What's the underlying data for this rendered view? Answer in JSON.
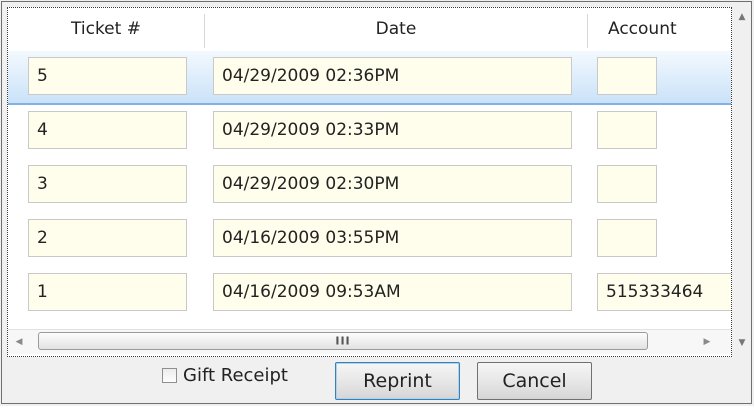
{
  "columns": [
    "Ticket #",
    "Date",
    "Account"
  ],
  "rows": [
    {
      "ticket": "5",
      "date": "04/29/2009 02:36PM",
      "account": "",
      "selected": true
    },
    {
      "ticket": "4",
      "date": "04/29/2009 02:33PM",
      "account": "",
      "selected": false
    },
    {
      "ticket": "3",
      "date": "04/29/2009 02:30PM",
      "account": "",
      "selected": false
    },
    {
      "ticket": "2",
      "date": "04/16/2009 03:55PM",
      "account": "",
      "selected": false
    },
    {
      "ticket": "1",
      "date": "04/16/2009 09:53AM",
      "account": "515333464",
      "selected": false
    }
  ],
  "gift_receipt": {
    "label": "Gift Receipt",
    "checked": false
  },
  "buttons": {
    "reprint": "Reprint",
    "cancel": "Cancel"
  },
  "scrollbar": {
    "grip": "III",
    "left_arrow": "◀",
    "right_arrow": "▶",
    "up_arrow": "▲",
    "down_arrow": "▼"
  },
  "colors": {
    "cell_bg": "#fffdeb",
    "selection": "#c8e1f8"
  }
}
